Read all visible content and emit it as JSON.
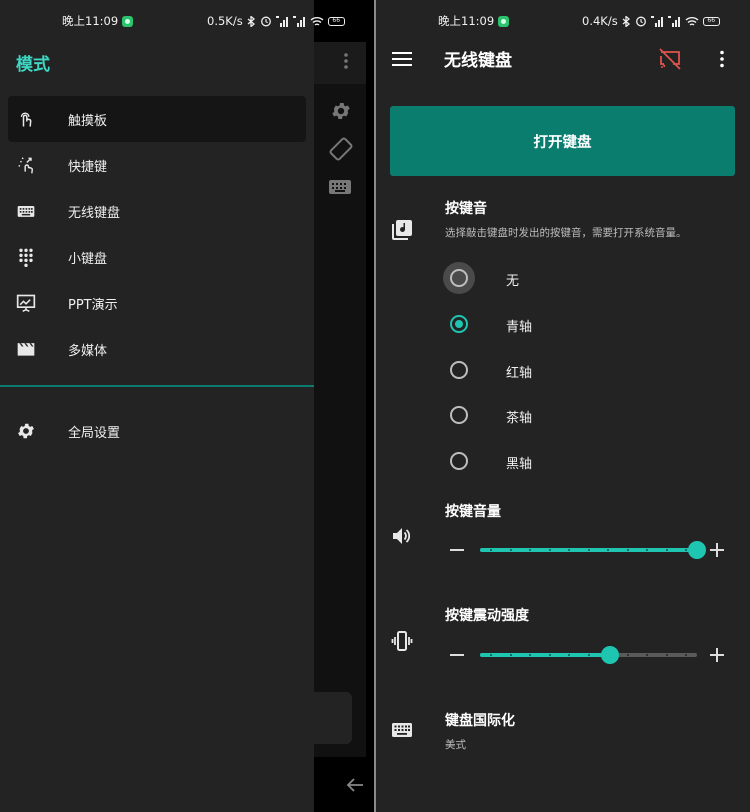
{
  "left_status": {
    "time": "晚上11:09",
    "net": "0.5K/s"
  },
  "right_status": {
    "time": "晚上11:09",
    "net": "0.4K/s"
  },
  "battery": "66",
  "drawer": {
    "title": "模式",
    "items": [
      {
        "label": "触摸板",
        "icon": "touchpad-icon",
        "selected": true
      },
      {
        "label": "快捷键",
        "icon": "shortcut-icon"
      },
      {
        "label": "无线键盘",
        "icon": "keyboard-icon"
      },
      {
        "label": "小键盘",
        "icon": "dialpad-icon"
      },
      {
        "label": "PPT演示",
        "icon": "presentation-icon"
      },
      {
        "label": "多媒体",
        "icon": "movie-icon"
      }
    ],
    "settings": {
      "label": "全局设置",
      "icon": "gear-icon"
    }
  },
  "app": {
    "title": "无线键盘",
    "open_button": "打开键盘"
  },
  "key_sound": {
    "title": "按键音",
    "description": "选择敲击键盘时发出的按键音，需要打开系统音量。",
    "options": [
      "无",
      "青轴",
      "红轴",
      "茶轴",
      "黑轴"
    ],
    "selected": "青轴"
  },
  "key_volume": {
    "title": "按键音量",
    "level": 1.0
  },
  "vibration": {
    "title": "按键震动强度",
    "level": 0.6
  },
  "locale": {
    "title": "键盘国际化",
    "value": "美式"
  },
  "colors": {
    "accent": "#1ec5b1",
    "button": "#0a7d6f",
    "drawer_title": "#3dd7c4",
    "disconnected": "#e0544d"
  }
}
